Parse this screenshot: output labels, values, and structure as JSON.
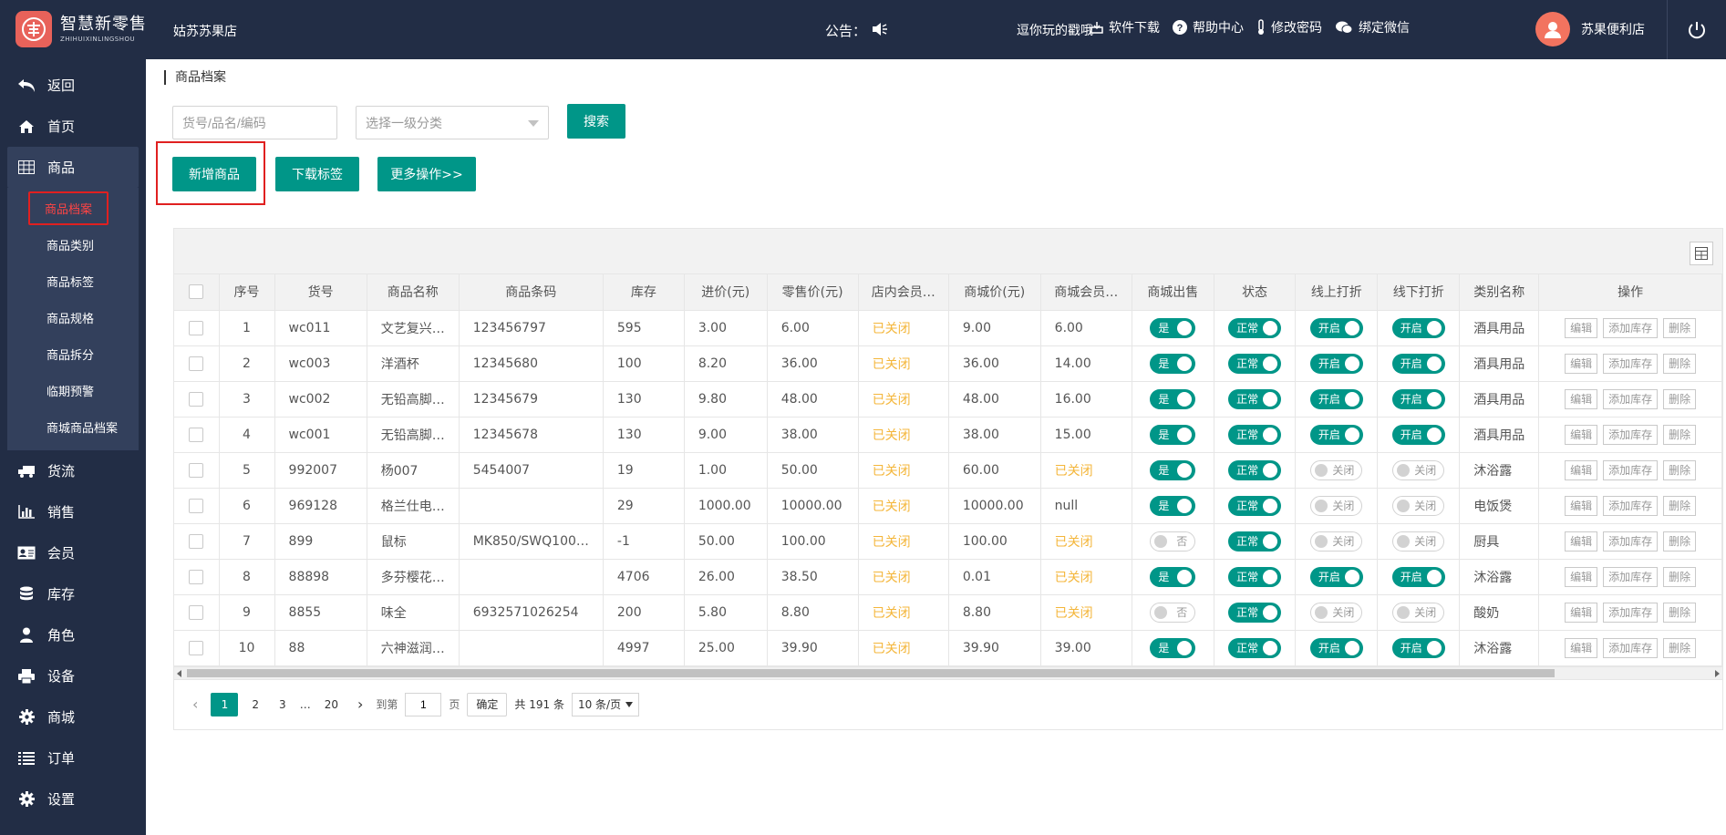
{
  "brand": {
    "name_cn": "智慧新零售",
    "name_en": "ZHIHUIXINLINGSHOU",
    "accent": "#009688",
    "nav_bg": "#222d45"
  },
  "header": {
    "store_name": "姑苏苏果店",
    "notice_label": "公告：",
    "marquee_text": "逗你玩的戳哦",
    "links": {
      "download": "软件下载",
      "help": "帮助中心",
      "password": "修改密码",
      "wechat": "绑定微信"
    },
    "user_name": "苏果便利店"
  },
  "sidebar": {
    "items": [
      {
        "label": "返回",
        "icon": "back-arrow-icon"
      },
      {
        "label": "首页",
        "icon": "home-icon"
      },
      {
        "label": "商品",
        "icon": "grid-icon"
      },
      {
        "label": "货流",
        "icon": "truck-icon"
      },
      {
        "label": "销售",
        "icon": "bar-chart-icon"
      },
      {
        "label": "会员",
        "icon": "id-card-icon"
      },
      {
        "label": "库存",
        "icon": "database-icon"
      },
      {
        "label": "角色",
        "icon": "user-icon"
      },
      {
        "label": "设备",
        "icon": "printer-icon"
      },
      {
        "label": "商城",
        "icon": "gear-icon"
      },
      {
        "label": "订单",
        "icon": "list-icon"
      },
      {
        "label": "设置",
        "icon": "gear-icon"
      }
    ],
    "sub_items": [
      "商品档案",
      "商品类别",
      "商品标签",
      "商品规格",
      "商品拆分",
      "临期预警",
      "商城商品档案"
    ]
  },
  "page": {
    "breadcrumb": "商品档案",
    "search_placeholder": "货号/品名/编码",
    "category_placeholder": "选择一级分类",
    "search_button": "搜索",
    "add_button": "新增商品",
    "download_button": "下载标签",
    "more_button": "更多操作>>"
  },
  "table": {
    "headers": [
      "序号",
      "货号",
      "商品名称",
      "商品条码",
      "库存",
      "进价(元)",
      "零售价(元)",
      "店内会员…",
      "商城价(元)",
      "商城会员…",
      "商城出售",
      "状态",
      "线上打折",
      "线下打折",
      "类别名称",
      "操作"
    ],
    "actions": {
      "edit": "编辑",
      "add_stock": "添加库存",
      "delete": "删除"
    },
    "rows": [
      {
        "no": "1",
        "code": "wc011",
        "name": "文艺复兴…",
        "barcode": "123456797",
        "stock": "595",
        "cost": "3.00",
        "retail": "6.00",
        "member": "已关闭",
        "mall_price": "9.00",
        "mall_member": "6.00",
        "mall_sale": "是",
        "mall_sale_on": true,
        "status": "正常",
        "online": "开启",
        "online_on": true,
        "offline": "开启",
        "offline_on": true,
        "category": "酒具用品"
      },
      {
        "no": "2",
        "code": "wc003",
        "name": "洋酒杯",
        "barcode": "12345680",
        "stock": "100",
        "cost": "8.20",
        "retail": "36.00",
        "member": "已关闭",
        "mall_price": "36.00",
        "mall_member": "14.00",
        "mall_sale": "是",
        "mall_sale_on": true,
        "status": "正常",
        "online": "开启",
        "online_on": true,
        "offline": "开启",
        "offline_on": true,
        "category": "酒具用品"
      },
      {
        "no": "3",
        "code": "wc002",
        "name": "无铅高脚…",
        "barcode": "12345679",
        "stock": "130",
        "cost": "9.80",
        "retail": "48.00",
        "member": "已关闭",
        "mall_price": "48.00",
        "mall_member": "16.00",
        "mall_sale": "是",
        "mall_sale_on": true,
        "status": "正常",
        "online": "开启",
        "online_on": true,
        "offline": "开启",
        "offline_on": true,
        "category": "酒具用品"
      },
      {
        "no": "4",
        "code": "wc001",
        "name": "无铅高脚…",
        "barcode": "12345678",
        "stock": "130",
        "cost": "9.00",
        "retail": "38.00",
        "member": "已关闭",
        "mall_price": "38.00",
        "mall_member": "15.00",
        "mall_sale": "是",
        "mall_sale_on": true,
        "status": "正常",
        "online": "开启",
        "online_on": true,
        "offline": "开启",
        "offline_on": true,
        "category": "酒具用品"
      },
      {
        "no": "5",
        "code": "992007",
        "name": "杨007",
        "barcode": "5454007",
        "stock": "19",
        "cost": "1.00",
        "retail": "50.00",
        "member": "已关闭",
        "mall_price": "60.00",
        "mall_member": "已关闭",
        "mall_sale": "是",
        "mall_sale_on": true,
        "status": "正常",
        "online": "关闭",
        "online_on": false,
        "offline": "关闭",
        "offline_on": false,
        "category": "沐浴露"
      },
      {
        "no": "6",
        "code": "969128",
        "name": "格兰仕电…",
        "barcode": "",
        "stock": "29",
        "cost": "1000.00",
        "retail": "10000.00",
        "member": "已关闭",
        "mall_price": "10000.00",
        "mall_member": "null",
        "mall_sale": "是",
        "mall_sale_on": true,
        "status": "正常",
        "online": "关闭",
        "online_on": false,
        "offline": "关闭",
        "offline_on": false,
        "category": "电饭煲"
      },
      {
        "no": "7",
        "code": "899",
        "name": "鼠标",
        "barcode": "MK850/SWQ100…",
        "stock": "-1",
        "cost": "50.00",
        "retail": "100.00",
        "member": "已关闭",
        "mall_price": "100.00",
        "mall_member": "已关闭",
        "mall_sale": "否",
        "mall_sale_on": false,
        "status": "正常",
        "online": "关闭",
        "online_on": false,
        "offline": "关闭",
        "offline_on": false,
        "category": "厨具"
      },
      {
        "no": "8",
        "code": "88898",
        "name": "多芬樱花…",
        "barcode": "",
        "stock": "4706",
        "cost": "26.00",
        "retail": "38.50",
        "member": "已关闭",
        "mall_price": "0.01",
        "mall_member": "已关闭",
        "mall_sale": "是",
        "mall_sale_on": true,
        "status": "正常",
        "online": "开启",
        "online_on": true,
        "offline": "开启",
        "offline_on": true,
        "category": "沐浴露"
      },
      {
        "no": "9",
        "code": "8855",
        "name": "味全",
        "barcode": "6932571026254",
        "stock": "200",
        "cost": "5.80",
        "retail": "8.80",
        "member": "已关闭",
        "mall_price": "8.80",
        "mall_member": "已关闭",
        "mall_sale": "否",
        "mall_sale_on": false,
        "status": "正常",
        "online": "关闭",
        "online_on": false,
        "offline": "关闭",
        "offline_on": false,
        "category": "酸奶"
      },
      {
        "no": "10",
        "code": "88",
        "name": "六神滋润…",
        "barcode": "",
        "stock": "4997",
        "cost": "25.00",
        "retail": "39.90",
        "member": "已关闭",
        "mall_price": "39.90",
        "mall_member": "39.00",
        "mall_sale": "是",
        "mall_sale_on": true,
        "status": "正常",
        "online": "开启",
        "online_on": true,
        "offline": "开启",
        "offline_on": true,
        "category": "沐浴露"
      }
    ]
  },
  "pager": {
    "pages": [
      "1",
      "2",
      "3",
      "…",
      "20"
    ],
    "current": "1",
    "goto_label": "到第",
    "goto_value": "1",
    "page_unit": "页",
    "confirm": "确定",
    "total": "共 191 条",
    "page_size": "10 条/页"
  }
}
